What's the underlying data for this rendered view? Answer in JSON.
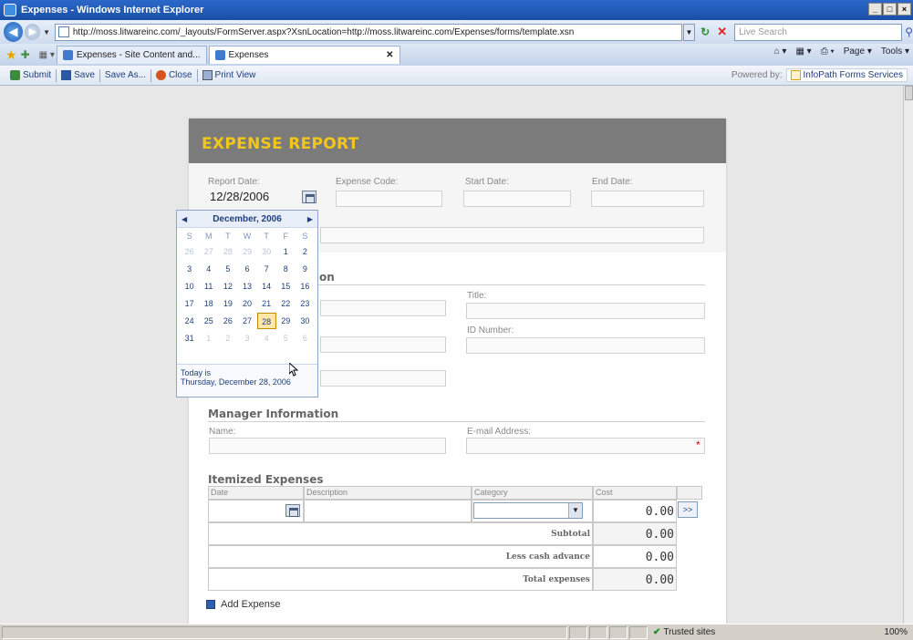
{
  "window": {
    "title": "Expenses - Windows Internet Explorer",
    "controls": [
      "_",
      "□",
      "×"
    ]
  },
  "browser": {
    "url": "http://moss.litwareinc.com/_layouts/FormServer.aspx?XsnLocation=http://moss.litwareinc.com/Expenses/forms/template.xsn",
    "search_placeholder": "Live Search",
    "tabs": [
      {
        "label": "Expenses - Site Content and...",
        "active": false
      },
      {
        "label": "Expenses",
        "active": true
      }
    ],
    "tools": {
      "home": "⌂ ▾",
      "feeds": "▦ ▾",
      "print": "⎙ ▾",
      "page": "Page ▾",
      "tools": "Tools ▾"
    }
  },
  "form_toolbar": {
    "submit": "Submit",
    "save": "Save",
    "save_as": "Save As...",
    "close": "Close",
    "print_view": "Print View",
    "powered_by": "Powered by:",
    "brand": "InfoPath Forms Services"
  },
  "form": {
    "title": "EXPENSE REPORT",
    "report_date_label": "Report Date:",
    "report_date_value": "12/28/2006",
    "expense_code_label": "Expense Code:",
    "start_date_label": "Start Date:",
    "end_date_label": "End Date:",
    "employee_section_tail": "on",
    "title_label": "Title:",
    "id_number_label": "ID Number:",
    "manager_section": "Manager Information",
    "manager_name_label": "Name:",
    "manager_email_label": "E-mail Address:",
    "required_marker": "*",
    "itemized_section": "Itemized Expenses",
    "columns": [
      "Date",
      "Description",
      "Category",
      "Cost"
    ],
    "row_cost": "0.00",
    "more_button": ">>",
    "subtotal_label": "Subtotal",
    "subtotal_value": "0.00",
    "less_cash_label": "Less cash advance",
    "less_cash_value": "0.00",
    "total_label": "Total expenses",
    "total_value": "0.00",
    "add_expense": "Add Expense"
  },
  "calendar": {
    "month": "December, 2006",
    "weekdays": [
      "S",
      "M",
      "T",
      "W",
      "T",
      "F",
      "S"
    ],
    "weeks": [
      [
        "26",
        "27",
        "28",
        "29",
        "30",
        "1",
        "2"
      ],
      [
        "3",
        "4",
        "5",
        "6",
        "7",
        "8",
        "9"
      ],
      [
        "10",
        "11",
        "12",
        "13",
        "14",
        "15",
        "16"
      ],
      [
        "17",
        "18",
        "19",
        "20",
        "21",
        "22",
        "23"
      ],
      [
        "24",
        "25",
        "26",
        "27",
        "28",
        "29",
        "30"
      ],
      [
        "31",
        "1",
        "2",
        "3",
        "4",
        "5",
        "6"
      ]
    ],
    "selected_day": "28",
    "today_line1": "Today is",
    "today_line2": "Thursday, December 28, 2006"
  },
  "status_bar": {
    "zone": "Trusted sites",
    "zoom": "100%"
  },
  "colors": {
    "header_bg": "#7b7b7b",
    "title_accent": "#f2c61a",
    "required": "#dd0000"
  }
}
